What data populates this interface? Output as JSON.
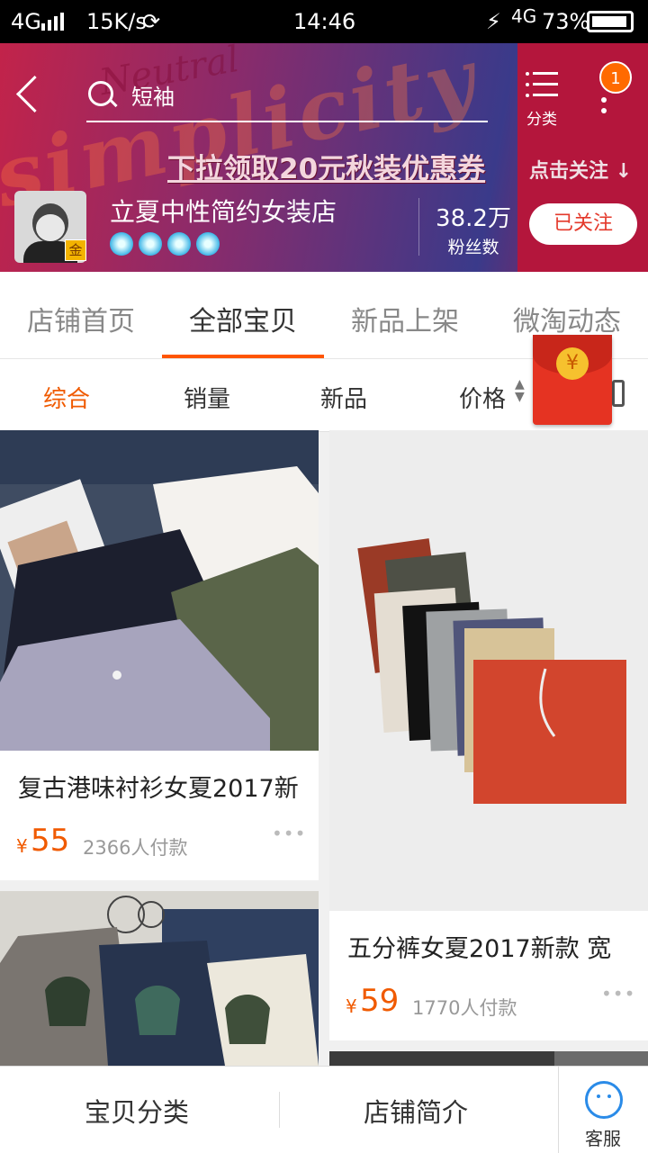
{
  "status_bar": {
    "network": "4G",
    "speed": "15K/s",
    "time": "14:46",
    "network2": "4G",
    "battery": "73%"
  },
  "header": {
    "search_text": "短袖",
    "category_label": "分类",
    "notification_count": "1",
    "promo_text": "下拉领取20元秋装优惠券",
    "follow_hint": "点击关注",
    "shop_name": "立夏中性简约女装店",
    "gold_badge": "金",
    "fans_count": "38.2万",
    "fans_label": "粉丝数",
    "followed_label": "已关注",
    "decor_text": "simplicity",
    "decor_text2": "Neutral"
  },
  "tabs": [
    {
      "label": "店铺首页"
    },
    {
      "label": "全部宝贝"
    },
    {
      "label": "新品上架"
    },
    {
      "label": "微淘动态"
    }
  ],
  "sort": [
    "综合",
    "销量",
    "新品",
    "价格"
  ],
  "red_packet_symbol": "¥",
  "products": [
    {
      "title": "复古港味衬衫女夏2017新",
      "currency": "¥",
      "price": "55",
      "sales": "2366人付款"
    },
    {
      "title": "五分裤女夏2017新款 宽",
      "currency": "¥",
      "price": "59",
      "sales": "1770人付款"
    }
  ],
  "bottom_bar": {
    "category": "宝贝分类",
    "intro": "店铺简介",
    "service": "客服"
  },
  "colors": {
    "accent": "#f05a00",
    "follow_button_text": "#e4392b",
    "service_icon": "#2a8be8"
  }
}
